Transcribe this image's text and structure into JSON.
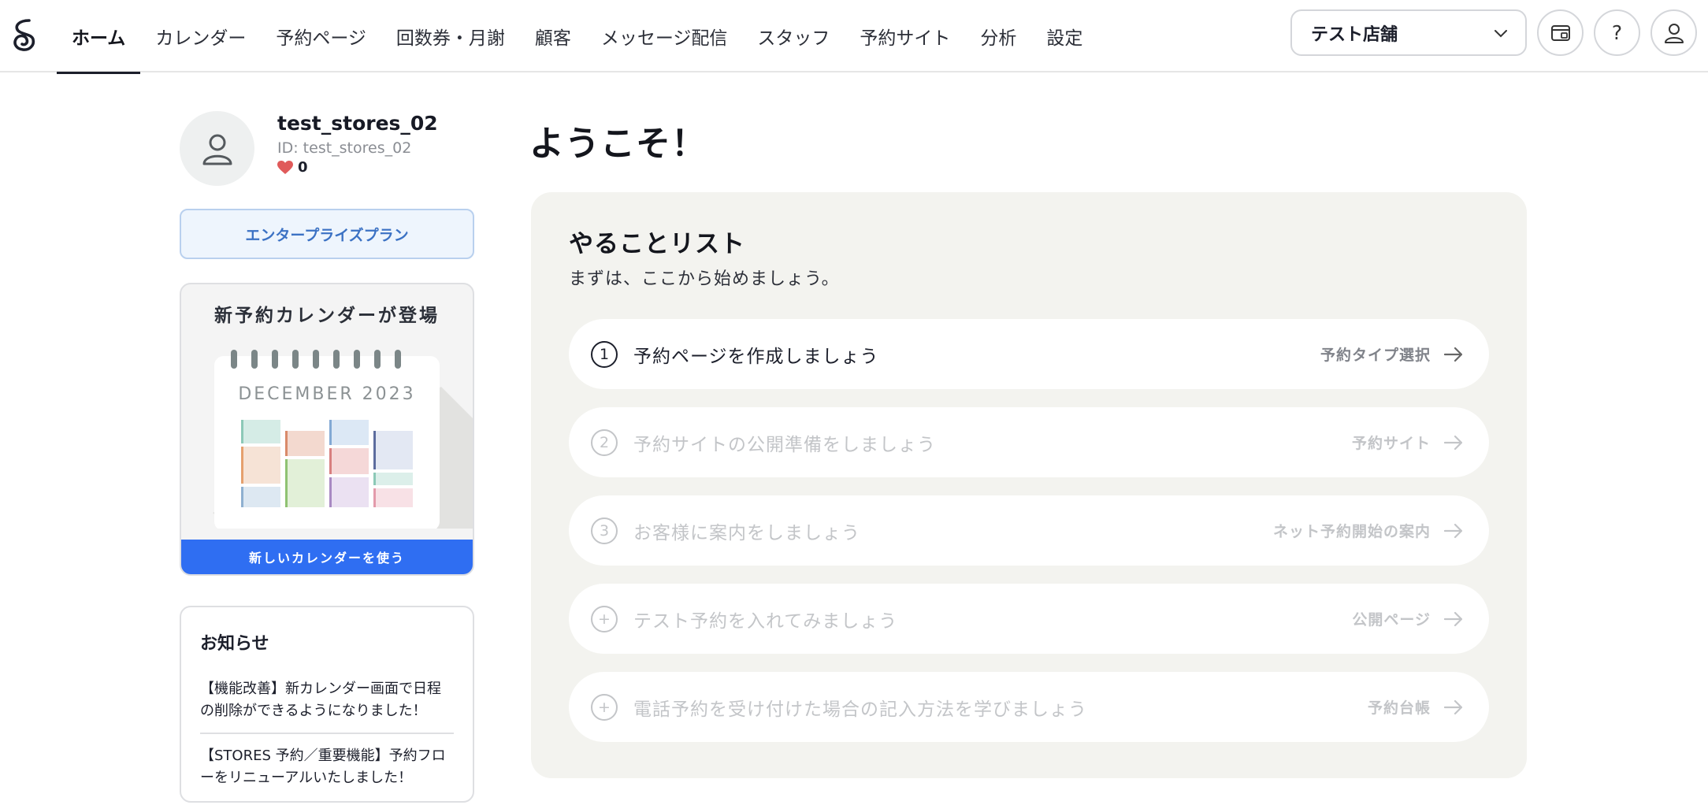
{
  "nav": {
    "items": [
      {
        "label": "ホーム",
        "active": true
      },
      {
        "label": "カレンダー"
      },
      {
        "label": "予約ページ"
      },
      {
        "label": "回数券・月謝"
      },
      {
        "label": "顧客"
      },
      {
        "label": "メッセージ配信"
      },
      {
        "label": "スタッフ"
      },
      {
        "label": "予約サイト"
      },
      {
        "label": "分析"
      },
      {
        "label": "設定"
      }
    ],
    "store_select": "テスト店舗",
    "help_label": "?"
  },
  "profile": {
    "name": "test_stores_02",
    "id_text": "ID: test_stores_02",
    "likes": "0",
    "plan": "エンタープライズプラン"
  },
  "promo": {
    "title": "新予約カレンダーが登場",
    "calendar_month": "DECEMBER 2023",
    "cta": "新しいカレンダーを使う"
  },
  "news": {
    "title": "お知らせ",
    "items": [
      "【機能改善】新カレンダー画面で日程の削除ができるようになりました！",
      "【STORES 予約／重要機能】予約フローをリニューアルいたしました！"
    ]
  },
  "main": {
    "welcome": "ようこそ！",
    "todo_title": "やることリスト",
    "todo_sub": "まずは、ここから始めましょう。",
    "tasks": [
      {
        "marker": "1",
        "label": "予約ページを作成しましょう",
        "action": "予約タイプ選択",
        "enabled": true
      },
      {
        "marker": "2",
        "label": "予約サイトの公開準備をしましょう",
        "action": "予約サイト",
        "enabled": false
      },
      {
        "marker": "3",
        "label": "お客様に案内をしましょう",
        "action": "ネット予約開始の案内",
        "enabled": false
      },
      {
        "marker": "+",
        "label": "テスト予約を入れてみましょう",
        "action": "公開ページ",
        "enabled": false
      },
      {
        "marker": "+",
        "label": "電話予約を受け付けた場合の記入方法を学びましょう",
        "action": "予約台帳",
        "enabled": false
      }
    ]
  },
  "colors": {
    "accent_blue": "#2f6ef2",
    "plan_blue": "#3c72c4",
    "heart": "#e05a5a"
  }
}
